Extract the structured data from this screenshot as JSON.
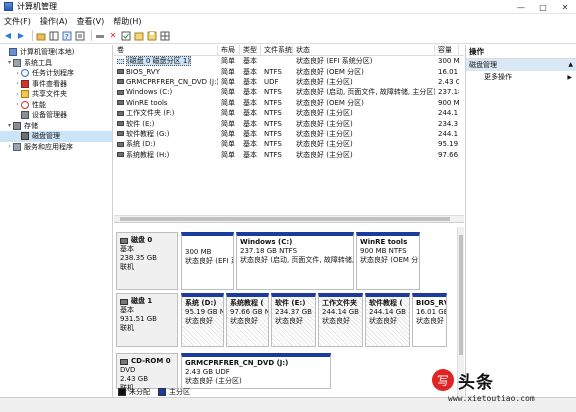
{
  "window": {
    "title": "计算机管理",
    "controls": [
      "—",
      "□",
      "✕"
    ]
  },
  "menu": [
    "文件(F)",
    "操作(A)",
    "查看(V)",
    "帮助(H)"
  ],
  "toolbar": [
    "back-icon",
    "forward-icon",
    "up-icon",
    "show-tree-icon",
    "help-icon",
    "properties-icon",
    "connect-icon",
    "delete-icon",
    "check-icon",
    "open-icon",
    "save-icon",
    "grid-icon"
  ],
  "tree": [
    {
      "label": "计算机管理(本地)",
      "level": 0,
      "exp": "",
      "icon": "computer-icon"
    },
    {
      "label": "系统工具",
      "level": 1,
      "exp": "▾",
      "icon": "tools-icon"
    },
    {
      "label": "任务计划程序",
      "level": 2,
      "exp": "›",
      "icon": "clock-icon"
    },
    {
      "label": "事件查看器",
      "level": 2,
      "exp": "›",
      "icon": "event-icon"
    },
    {
      "label": "共享文件夹",
      "level": 2,
      "exp": "›",
      "icon": "folder-icon"
    },
    {
      "label": "性能",
      "level": 2,
      "exp": "›",
      "icon": "perf-icon"
    },
    {
      "label": "设备管理器",
      "level": 2,
      "exp": "",
      "icon": "device-icon"
    },
    {
      "label": "存储",
      "level": 1,
      "exp": "▾",
      "icon": "storage-icon"
    },
    {
      "label": "磁盘管理",
      "level": 2,
      "exp": "",
      "icon": "disk-icon",
      "selected": true
    },
    {
      "label": "服务和应用程序",
      "level": 1,
      "exp": "›",
      "icon": "services-icon"
    }
  ],
  "table": {
    "headers": [
      "卷",
      "布局",
      "类型",
      "文件系统",
      "状态",
      "容量"
    ],
    "rows": [
      [
        "(磁盘 0 磁盘分区 1)",
        "简单",
        "基本",
        "",
        "状态良好 (EFI 系统分区)",
        "300 M"
      ],
      [
        "BIOS_RVY",
        "简单",
        "基本",
        "NTFS",
        "状态良好 (OEM 分区)",
        "16.01"
      ],
      [
        "GRMCPRFRER_CN_DVD (J:)",
        "简单",
        "基本",
        "UDF",
        "状态良好 (主分区)",
        "2.43 G"
      ],
      [
        "Windows (C:)",
        "简单",
        "基本",
        "NTFS",
        "状态良好 (启动, 页面文件, 故障转储, 主分区)",
        "237.18"
      ],
      [
        "WinRE tools",
        "简单",
        "基本",
        "NTFS",
        "状态良好 (OEM 分区)",
        "900 M"
      ],
      [
        "工作文件夹 (F:)",
        "简单",
        "基本",
        "NTFS",
        "状态良好 (主分区)",
        "244.1"
      ],
      [
        "软件 (E:)",
        "简单",
        "基本",
        "NTFS",
        "状态良好 (主分区)",
        "234.3"
      ],
      [
        "软件教程 (G:)",
        "简单",
        "基本",
        "NTFS",
        "状态良好 (主分区)",
        "244.1"
      ],
      [
        "系统 (D:)",
        "简单",
        "基本",
        "NTFS",
        "状态良好 (主分区)",
        "95.19"
      ],
      [
        "系统教程 (H:)",
        "简单",
        "基本",
        "NTFS",
        "状态良好 (主分区)",
        "97.66"
      ]
    ]
  },
  "disks": [
    {
      "name": "磁盘 0",
      "type": "基本",
      "size": "238.35 GB",
      "status": "联机",
      "partitions": [
        {
          "name": "",
          "size": "300 MB",
          "status": "状态良好 (EFI 系"
        },
        {
          "name": "Windows  (C:)",
          "size": "237.18 GB NTFS",
          "status": "状态良好 (启动, 页面文件, 故障转储,"
        },
        {
          "name": "WinRE tools",
          "size": "900 MB NTFS",
          "status": "状态良好 (OEM 分"
        }
      ]
    },
    {
      "name": "磁盘 1",
      "type": "基本",
      "size": "931.51 GB",
      "status": "联机",
      "partitions": [
        {
          "name": "系统  (D:)",
          "size": "95.19 GB N",
          "status": "状态良好"
        },
        {
          "name": "系统教程 (",
          "size": "97.66 GB N",
          "status": "状态良好"
        },
        {
          "name": "软件  (E:)",
          "size": "234.37 GB",
          "status": "状态良好"
        },
        {
          "name": "工作文件夹",
          "size": "244.14 GB",
          "status": "状态良好"
        },
        {
          "name": "软件教程  (",
          "size": "244.14 GB",
          "status": "状态良好"
        },
        {
          "name": "BIOS_RV",
          "size": "16.01 GB",
          "status": "状态良好"
        }
      ]
    },
    {
      "name": "CD-ROM 0",
      "type": "DVD",
      "size": "2.43 GB",
      "status": "联机",
      "partitions": [
        {
          "name": "GRMCPRFRER_CN_DVD  (J:)",
          "size": "2.43 GB UDF",
          "status": "状态良好 (主分区)"
        }
      ]
    }
  ],
  "legend": [
    {
      "label": "未分配",
      "color": "#111111"
    },
    {
      "label": "主分区",
      "color": "#1c3ba0"
    }
  ],
  "actions": {
    "header": "操作",
    "section": "磁盘管理",
    "section_arrow": "▲",
    "items": [
      {
        "label": "更多操作",
        "arrow": "▶"
      }
    ]
  },
  "watermark": {
    "brand": "头条",
    "logo_char": "写",
    "url": "www.xietoutiao.com"
  }
}
